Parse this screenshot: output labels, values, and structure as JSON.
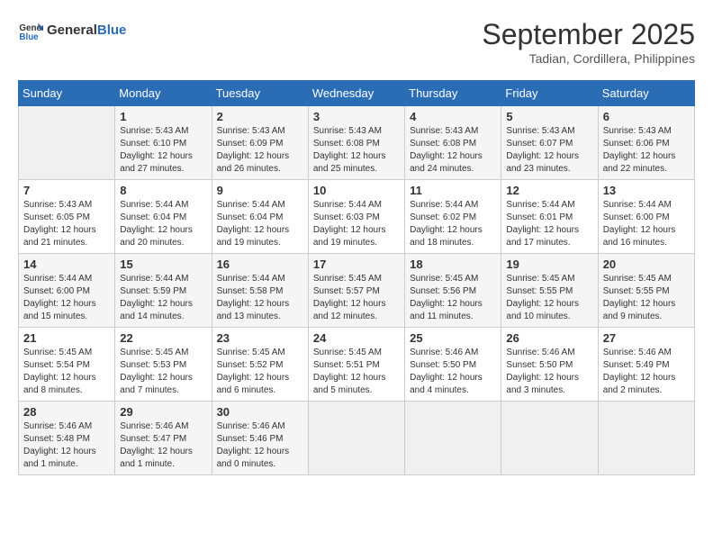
{
  "header": {
    "logo_line1": "General",
    "logo_line2": "Blue",
    "month": "September 2025",
    "location": "Tadian, Cordillera, Philippines"
  },
  "days_of_week": [
    "Sunday",
    "Monday",
    "Tuesday",
    "Wednesday",
    "Thursday",
    "Friday",
    "Saturday"
  ],
  "weeks": [
    [
      {
        "day": "",
        "info": ""
      },
      {
        "day": "1",
        "info": "Sunrise: 5:43 AM\nSunset: 6:10 PM\nDaylight: 12 hours\nand 27 minutes."
      },
      {
        "day": "2",
        "info": "Sunrise: 5:43 AM\nSunset: 6:09 PM\nDaylight: 12 hours\nand 26 minutes."
      },
      {
        "day": "3",
        "info": "Sunrise: 5:43 AM\nSunset: 6:08 PM\nDaylight: 12 hours\nand 25 minutes."
      },
      {
        "day": "4",
        "info": "Sunrise: 5:43 AM\nSunset: 6:08 PM\nDaylight: 12 hours\nand 24 minutes."
      },
      {
        "day": "5",
        "info": "Sunrise: 5:43 AM\nSunset: 6:07 PM\nDaylight: 12 hours\nand 23 minutes."
      },
      {
        "day": "6",
        "info": "Sunrise: 5:43 AM\nSunset: 6:06 PM\nDaylight: 12 hours\nand 22 minutes."
      }
    ],
    [
      {
        "day": "7",
        "info": "Sunrise: 5:43 AM\nSunset: 6:05 PM\nDaylight: 12 hours\nand 21 minutes."
      },
      {
        "day": "8",
        "info": "Sunrise: 5:44 AM\nSunset: 6:04 PM\nDaylight: 12 hours\nand 20 minutes."
      },
      {
        "day": "9",
        "info": "Sunrise: 5:44 AM\nSunset: 6:04 PM\nDaylight: 12 hours\nand 19 minutes."
      },
      {
        "day": "10",
        "info": "Sunrise: 5:44 AM\nSunset: 6:03 PM\nDaylight: 12 hours\nand 19 minutes."
      },
      {
        "day": "11",
        "info": "Sunrise: 5:44 AM\nSunset: 6:02 PM\nDaylight: 12 hours\nand 18 minutes."
      },
      {
        "day": "12",
        "info": "Sunrise: 5:44 AM\nSunset: 6:01 PM\nDaylight: 12 hours\nand 17 minutes."
      },
      {
        "day": "13",
        "info": "Sunrise: 5:44 AM\nSunset: 6:00 PM\nDaylight: 12 hours\nand 16 minutes."
      }
    ],
    [
      {
        "day": "14",
        "info": "Sunrise: 5:44 AM\nSunset: 6:00 PM\nDaylight: 12 hours\nand 15 minutes."
      },
      {
        "day": "15",
        "info": "Sunrise: 5:44 AM\nSunset: 5:59 PM\nDaylight: 12 hours\nand 14 minutes."
      },
      {
        "day": "16",
        "info": "Sunrise: 5:44 AM\nSunset: 5:58 PM\nDaylight: 12 hours\nand 13 minutes."
      },
      {
        "day": "17",
        "info": "Sunrise: 5:45 AM\nSunset: 5:57 PM\nDaylight: 12 hours\nand 12 minutes."
      },
      {
        "day": "18",
        "info": "Sunrise: 5:45 AM\nSunset: 5:56 PM\nDaylight: 12 hours\nand 11 minutes."
      },
      {
        "day": "19",
        "info": "Sunrise: 5:45 AM\nSunset: 5:55 PM\nDaylight: 12 hours\nand 10 minutes."
      },
      {
        "day": "20",
        "info": "Sunrise: 5:45 AM\nSunset: 5:55 PM\nDaylight: 12 hours\nand 9 minutes."
      }
    ],
    [
      {
        "day": "21",
        "info": "Sunrise: 5:45 AM\nSunset: 5:54 PM\nDaylight: 12 hours\nand 8 minutes."
      },
      {
        "day": "22",
        "info": "Sunrise: 5:45 AM\nSunset: 5:53 PM\nDaylight: 12 hours\nand 7 minutes."
      },
      {
        "day": "23",
        "info": "Sunrise: 5:45 AM\nSunset: 5:52 PM\nDaylight: 12 hours\nand 6 minutes."
      },
      {
        "day": "24",
        "info": "Sunrise: 5:45 AM\nSunset: 5:51 PM\nDaylight: 12 hours\nand 5 minutes."
      },
      {
        "day": "25",
        "info": "Sunrise: 5:46 AM\nSunset: 5:50 PM\nDaylight: 12 hours\nand 4 minutes."
      },
      {
        "day": "26",
        "info": "Sunrise: 5:46 AM\nSunset: 5:50 PM\nDaylight: 12 hours\nand 3 minutes."
      },
      {
        "day": "27",
        "info": "Sunrise: 5:46 AM\nSunset: 5:49 PM\nDaylight: 12 hours\nand 2 minutes."
      }
    ],
    [
      {
        "day": "28",
        "info": "Sunrise: 5:46 AM\nSunset: 5:48 PM\nDaylight: 12 hours\nand 1 minute."
      },
      {
        "day": "29",
        "info": "Sunrise: 5:46 AM\nSunset: 5:47 PM\nDaylight: 12 hours\nand 1 minute."
      },
      {
        "day": "30",
        "info": "Sunrise: 5:46 AM\nSunset: 5:46 PM\nDaylight: 12 hours\nand 0 minutes."
      },
      {
        "day": "",
        "info": ""
      },
      {
        "day": "",
        "info": ""
      },
      {
        "day": "",
        "info": ""
      },
      {
        "day": "",
        "info": ""
      }
    ]
  ]
}
